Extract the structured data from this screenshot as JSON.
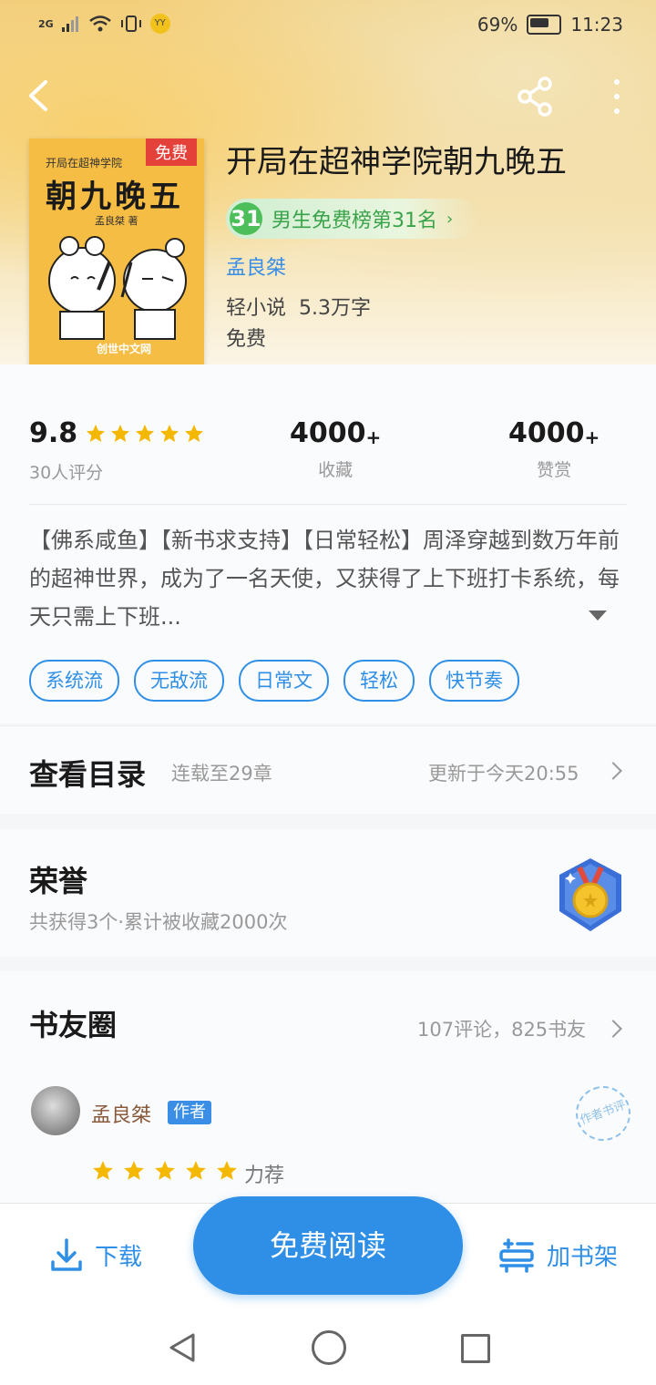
{
  "status_bar": {
    "signal": "2G",
    "battery": "69%",
    "time": "11:23",
    "app_badge": "YY"
  },
  "book": {
    "title": "开局在超神学院朝九晚五",
    "rank_number": "31",
    "rank_text": "男生免费榜第31名",
    "author": "孟良桀",
    "category": "轻小说",
    "word_count": "5.3万字",
    "price": "免费"
  },
  "cover": {
    "badge": "免费",
    "subtitle": "开局在超神学院",
    "title": "朝九晚五",
    "author": "孟良桀 著",
    "brand": "创世中文网"
  },
  "stats": {
    "rating": "9.8",
    "rating_count": "30人评分",
    "star_count": 5,
    "favorites": "4000",
    "favorites_label": "收藏",
    "rewards": "4000",
    "rewards_label": "赞赏",
    "plus": "+"
  },
  "description": "【佛系咸鱼】【新书求支持】【日常轻松】周泽穿越到数万年前的超神世界，成为了一名天使，又获得了上下班打卡系统，每天只需上下班...",
  "tags": [
    "系统流",
    "无敌流",
    "日常文",
    "轻松",
    "快节奏"
  ],
  "catalog": {
    "title": "查看目录",
    "progress": "连载至29章",
    "updated": "更新于今天20:55"
  },
  "honors": {
    "title": "荣誉",
    "summary": "共获得3个·累计被收藏2000次"
  },
  "community": {
    "title": "书友圈",
    "summary": "107评论，825书友",
    "comment": {
      "user": "孟良桀",
      "badge": "作者",
      "stamp": "作者书评",
      "stars": 5,
      "label": "力荐"
    }
  },
  "bottom_bar": {
    "download": "下载",
    "read": "免费阅读",
    "add_shelf": "加书架"
  },
  "colors": {
    "accent": "#2f8fe6",
    "rank_green": "#4cbf5b",
    "star": "#f5b800",
    "tag_red": "#e4413b"
  }
}
